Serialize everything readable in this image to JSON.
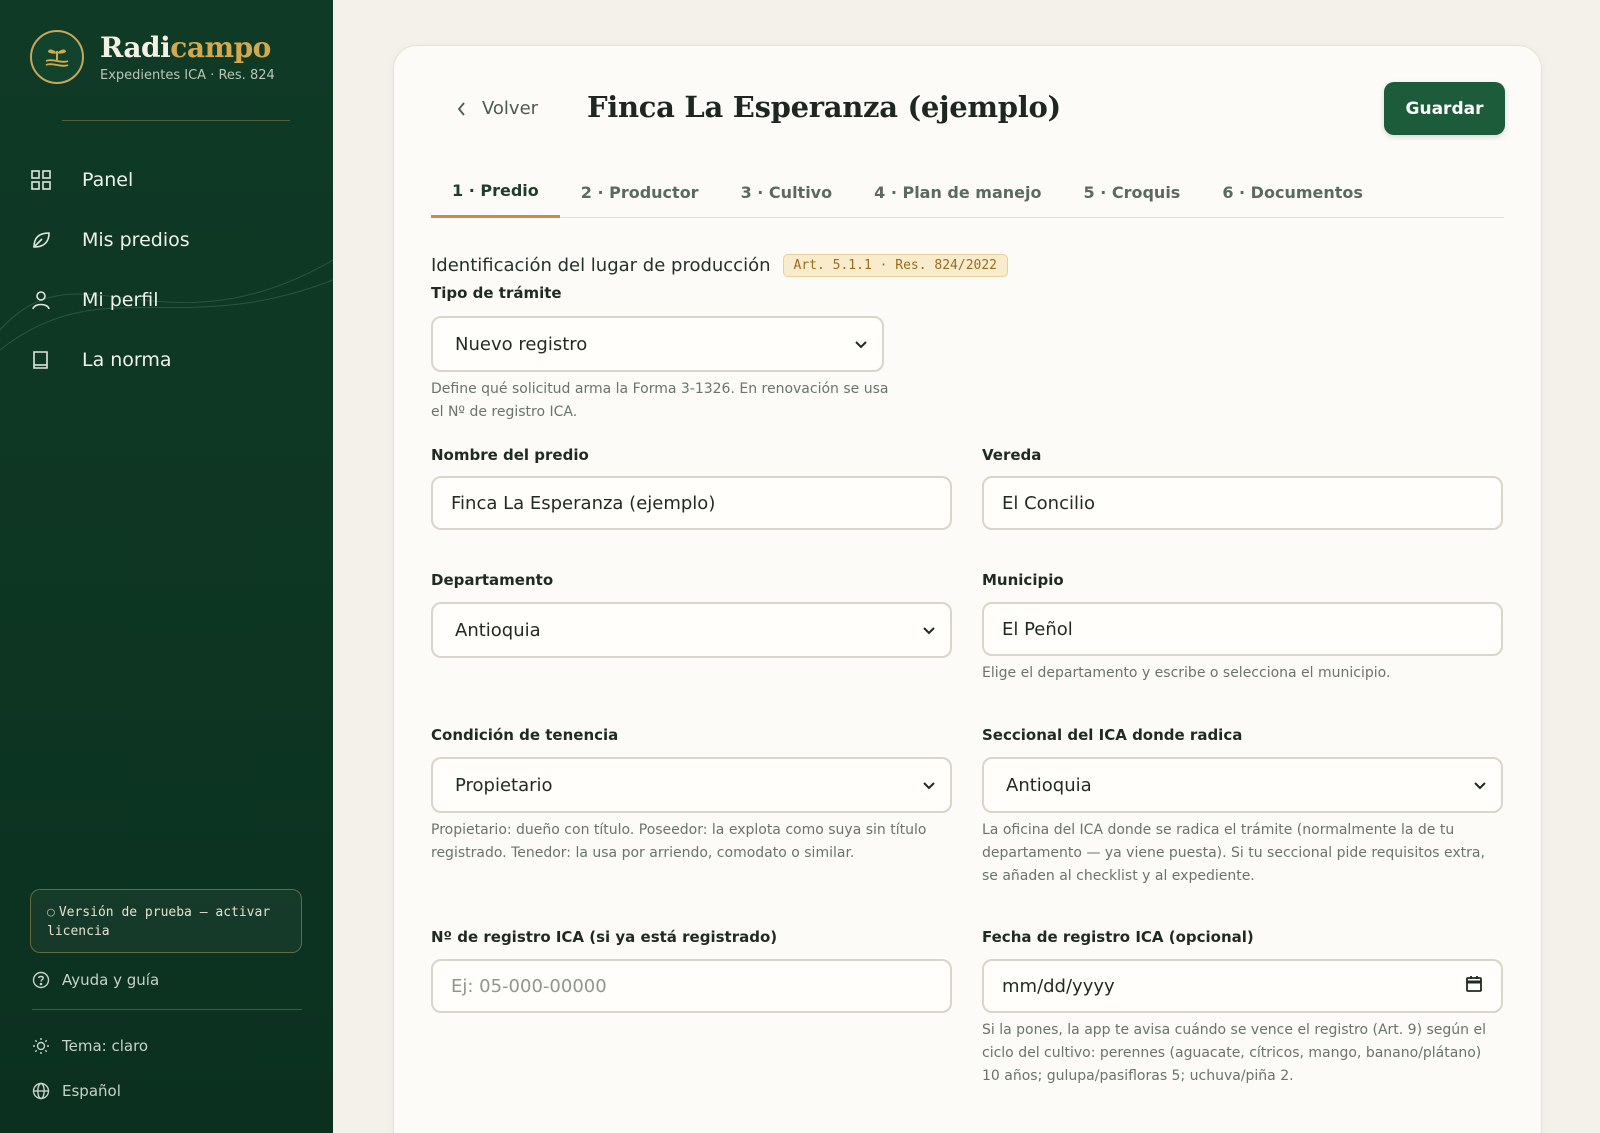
{
  "sidebar": {
    "brand": {
      "name_part1": "Radi",
      "name_part2": "campo",
      "subtitle": "Expedientes ICA · Res. 824"
    },
    "nav": [
      {
        "label": "Panel",
        "icon": "grid-icon"
      },
      {
        "label": "Mis predios",
        "icon": "leaf-icon"
      },
      {
        "label": "Mi perfil",
        "icon": "user-icon"
      },
      {
        "label": "La norma",
        "icon": "book-icon"
      }
    ],
    "trial_text": "Versión de prueba — activar licencia",
    "help_label": "Ayuda y guía",
    "theme_label": "Tema: claro",
    "language_label": "Español"
  },
  "header": {
    "back_label": "Volver",
    "title": "Finca La Esperanza (ejemplo)",
    "save_label": "Guardar"
  },
  "tabs": [
    {
      "label": "1 · Predio",
      "active": true
    },
    {
      "label": "2 · Productor",
      "active": false
    },
    {
      "label": "3 · Cultivo",
      "active": false
    },
    {
      "label": "4 · Plan de manejo",
      "active": false
    },
    {
      "label": "5 · Croquis",
      "active": false
    },
    {
      "label": "6 · Documentos",
      "active": false
    }
  ],
  "section": {
    "title": "Identificación del lugar de producción",
    "badge": "Art. 5.1.1 · Res. 824/2022"
  },
  "form": {
    "tipo_tramite": {
      "label": "Tipo de trámite",
      "value": "Nuevo registro",
      "help": "Define qué solicitud arma la Forma 3-1326. En renovación se usa el Nº de registro ICA."
    },
    "nombre_predio": {
      "label": "Nombre del predio",
      "value": "Finca La Esperanza (ejemplo)"
    },
    "vereda": {
      "label": "Vereda",
      "value": "El Concilio"
    },
    "departamento": {
      "label": "Departamento",
      "value": "Antioquia"
    },
    "municipio": {
      "label": "Municipio",
      "value": "El Peñol",
      "help": "Elige el departamento y escribe o selecciona el municipio."
    },
    "tenencia": {
      "label": "Condición de tenencia",
      "value": "Propietario",
      "help": "Propietario: dueño con título. Poseedor: la explota como suya sin título registrado. Tenedor: la usa por arriendo, comodato o similar."
    },
    "seccional": {
      "label": "Seccional del ICA donde radica",
      "value": "Antioquia",
      "help": "La oficina del ICA donde se radica el trámite (normalmente la de tu departamento — ya viene puesta). Si tu seccional pide requisitos extra, se añaden al checklist y al expediente."
    },
    "registro_ica": {
      "label": "Nº de registro ICA (si ya está registrado)",
      "placeholder": "Ej: 05-000-00000"
    },
    "fecha_registro": {
      "label": "Fecha de registro ICA (opcional)",
      "placeholder": "mm/dd/yyyy",
      "help": "Si la pones, la app te avisa cuándo se vence el registro (Art. 9) según el ciclo del cultivo: perennes (aguacate, cítricos, mango, banano/plátano) 10 años; gulupa/pasifloras 5; uchuva/piña 2."
    }
  },
  "colors": {
    "sidebar_bg": "#0f3a26",
    "accent_gold": "#d4a94e",
    "primary_button": "#1d5c3a",
    "tab_active_underline": "#c88a4a"
  }
}
